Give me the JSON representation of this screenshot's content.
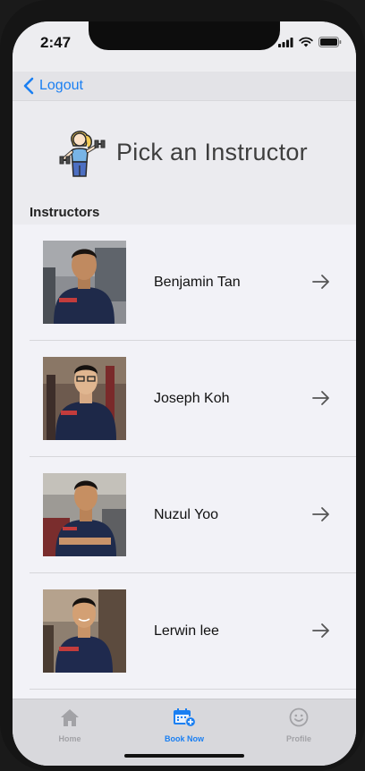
{
  "status": {
    "time": "2:47",
    "icons": [
      "signal-icon",
      "wifi-icon",
      "battery-icon"
    ]
  },
  "nav": {
    "back_label": "Logout",
    "back_icon": "chevron-left-icon",
    "accent": "#1a7ff2"
  },
  "header": {
    "title": "Pick an Instructor",
    "icon": "fitness-instructor-icon"
  },
  "section_label": "Instructors",
  "instructors": [
    {
      "name": "Benjamin Tan",
      "photo": "instructor-photo",
      "arrow": "arrow-right-icon"
    },
    {
      "name": "Joseph Koh",
      "photo": "instructor-photo",
      "arrow": "arrow-right-icon"
    },
    {
      "name": "Nuzul Yoo",
      "photo": "instructor-photo",
      "arrow": "arrow-right-icon"
    },
    {
      "name": "Lerwin lee",
      "photo": "instructor-photo",
      "arrow": "arrow-right-icon"
    }
  ],
  "tabs": [
    {
      "label": "Home",
      "icon": "home-icon",
      "active": false
    },
    {
      "label": "Book Now",
      "icon": "calendar-add-icon",
      "active": true
    },
    {
      "label": "Profile",
      "icon": "smiley-icon",
      "active": false
    }
  ]
}
